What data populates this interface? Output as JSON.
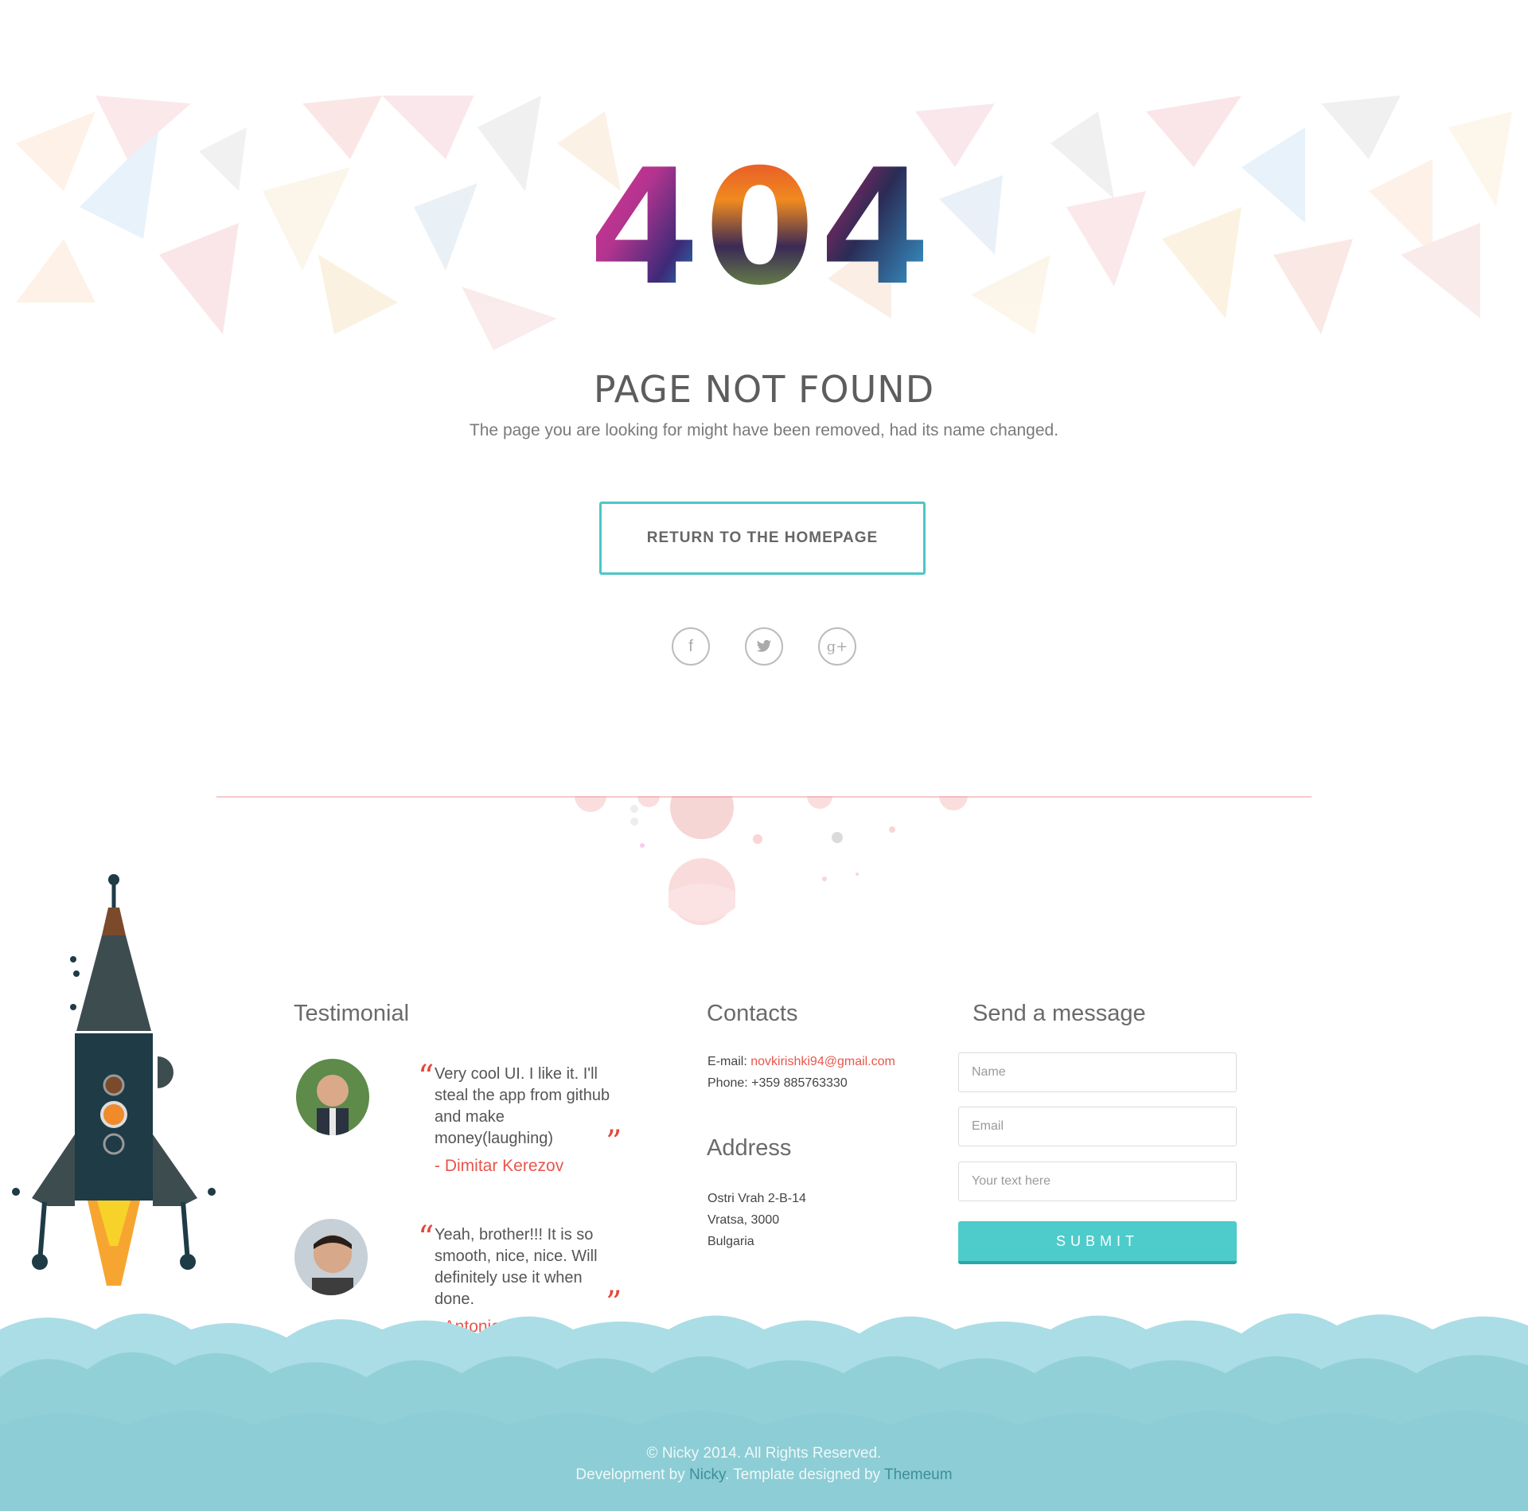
{
  "error": {
    "code": "404",
    "title": "PAGE NOT FOUND",
    "subtitle": "The page you are looking for might have been removed, had its name changed."
  },
  "actions": {
    "home_label": "RETURN TO THE HOMEPAGE"
  },
  "social": [
    {
      "name": "facebook-icon",
      "glyph": "f"
    },
    {
      "name": "twitter-icon",
      "glyph": "t"
    },
    {
      "name": "google-plus-icon",
      "glyph": "g+"
    }
  ],
  "testimonial": {
    "heading": "Testimonial",
    "items": [
      {
        "text": "Very cool UI. I like it. I'll steal the app from github and make money(laughing)",
        "author": "- Dimitar Kerezov"
      },
      {
        "text": "Yeah, brother!!! It is so smooth, nice, nice. Will definitely use it when done.",
        "author": "- Antonio Filipov"
      }
    ]
  },
  "contacts": {
    "heading": "Contacts",
    "email_label": "E-mail: ",
    "email": "novkirishki94@gmail.com",
    "phone": "Phone: +359 885763330"
  },
  "address": {
    "heading": "Address",
    "line1": "Ostri Vrah 2-B-14",
    "line2": "Vratsa, 3000",
    "line3": "Bulgaria"
  },
  "message": {
    "heading": "Send a message",
    "name_placeholder": "Name",
    "email_placeholder": "Email",
    "text_placeholder": "Your text here",
    "submit_label": "SUBMIT"
  },
  "footer": {
    "copyright": "© Nicky 2014. All Rights Reserved.",
    "dev_prefix": "Development by ",
    "dev_name": "Nicky",
    "designed_prefix": ". Template designed by ",
    "designer": "Themeum"
  },
  "colors": {
    "accent": "#4ecbcb",
    "highlight": "#e8564c",
    "cloud_light": "#abdde6",
    "cloud_dark": "#8fcfd6"
  }
}
